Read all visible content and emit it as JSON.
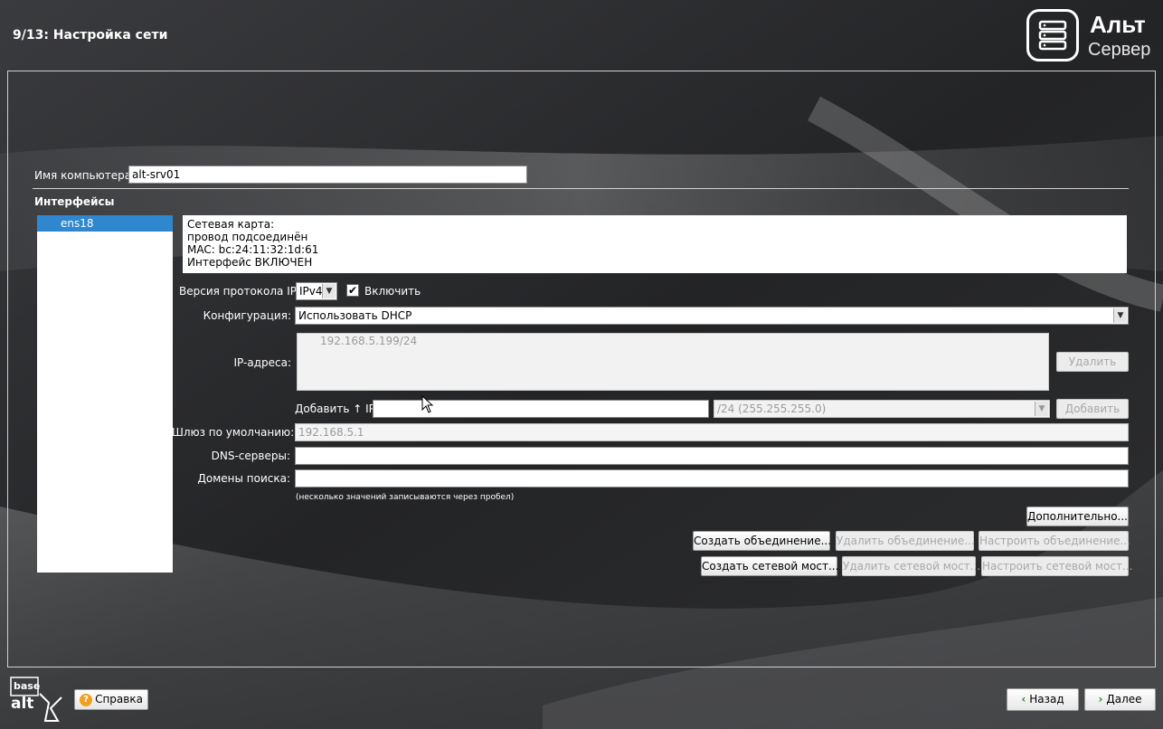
{
  "header": {
    "step_title": "9/13: Настройка сети",
    "logo_name": "Альт",
    "logo_subtitle": "Сервер"
  },
  "hostname": {
    "label": "Имя компьютера:",
    "value": "alt-srv01"
  },
  "interfaces": {
    "section_label": "Интерфейсы",
    "items": [
      {
        "label": "ens18",
        "selected": true
      }
    ],
    "info_lines": [
      "Сетевая карта:",
      "провод подсоединён",
      "MAC: bc:24:11:32:1d:61",
      "Интерфейс ВКЛЮЧЕН"
    ]
  },
  "ip_version": {
    "label": "Версия протокола IP:",
    "value": "IPv4",
    "enable_label": "Включить",
    "enabled": true
  },
  "configuration": {
    "label": "Конфигурация:",
    "value": "Использовать DHCP"
  },
  "ip_addresses": {
    "label": "IP-адреса:",
    "items": [
      "192.168.5.199/24"
    ],
    "delete_label": "Удалить"
  },
  "add_ip": {
    "label": "Добавить ↑ IP:",
    "value": "",
    "mask_value": "/24 (255.255.255.0)",
    "add_label": "Добавить"
  },
  "gateway": {
    "label": "Шлюз по умолчанию:",
    "value": "192.168.5.1"
  },
  "dns": {
    "label": "DNS-серверы:",
    "value": ""
  },
  "search_domains": {
    "label": "Домены поиска:",
    "value": ""
  },
  "hint": "(несколько значений записываются через пробел)",
  "buttons": {
    "advanced": "Дополнительно...",
    "create_bond": "Создать объединение...",
    "delete_bond": "Удалить объединение...",
    "configure_bond": "Настроить объединение...",
    "create_bridge": "Создать сетевой мост...",
    "delete_bridge": "Удалить сетевой мост...",
    "configure_bridge": "Настроить сетевой мост..."
  },
  "footer": {
    "brand_top": "base",
    "brand_bottom": "alt",
    "help_label": "Справка",
    "back_label": "Назад",
    "next_label": "Далее"
  },
  "colors": {
    "selection": "#2f87cf",
    "background": "#2a2b2d",
    "help_icon": "#f0a020",
    "nav_arrow": "#2a8a2a"
  }
}
